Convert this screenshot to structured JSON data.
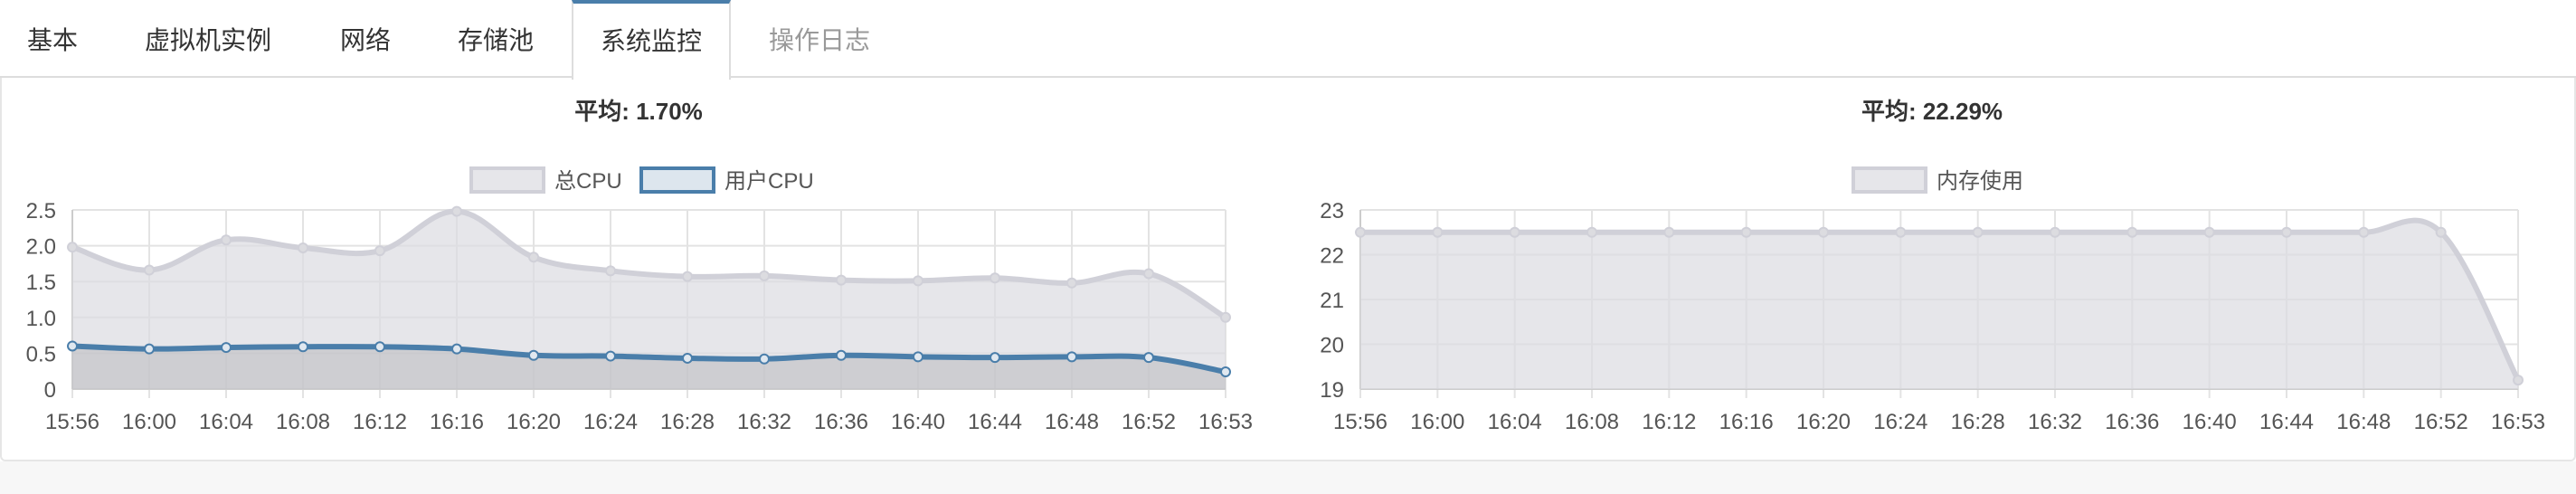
{
  "tabs": [
    {
      "label": "基本",
      "active": false,
      "disabled": false
    },
    {
      "label": "虚拟机实例",
      "active": false,
      "disabled": false
    },
    {
      "label": "网络",
      "active": false,
      "disabled": false
    },
    {
      "label": "存储池",
      "active": false,
      "disabled": false
    },
    {
      "label": "系统监控",
      "active": true,
      "disabled": false
    },
    {
      "label": "操作日志",
      "active": false,
      "disabled": true
    }
  ],
  "colors": {
    "accent": "#4a7eaa",
    "grey_series": "#d0d0d8",
    "grey_fill": "#e5e5e5",
    "grid": "#dddddd",
    "tab_border": "#dddddd"
  },
  "chart_data": [
    {
      "type": "area",
      "title": "平均: 1.70%",
      "legend_position": "top-center",
      "grid": true,
      "x": [
        "15:56",
        "16:00",
        "16:04",
        "16:08",
        "16:12",
        "16:16",
        "16:20",
        "16:24",
        "16:28",
        "16:32",
        "16:36",
        "16:40",
        "16:44",
        "16:48",
        "16:52",
        "16:53"
      ],
      "yticks": [
        "0",
        "0.5",
        "1.0",
        "1.5",
        "2.0",
        "2.5"
      ],
      "ylim": [
        0,
        2.5
      ],
      "series": [
        {
          "name": "总CPU",
          "color": "#d0d0d8",
          "values": [
            1.98,
            1.66,
            2.08,
            1.97,
            1.93,
            2.48,
            1.84,
            1.65,
            1.57,
            1.58,
            1.52,
            1.51,
            1.55,
            1.48,
            1.61,
            1.0
          ]
        },
        {
          "name": "用户CPU",
          "color": "#4a7eaa",
          "values": [
            0.6,
            0.56,
            0.58,
            0.59,
            0.59,
            0.56,
            0.47,
            0.46,
            0.43,
            0.42,
            0.47,
            0.45,
            0.44,
            0.45,
            0.44,
            0.24
          ]
        }
      ]
    },
    {
      "type": "area",
      "title": "平均: 22.29%",
      "legend_position": "top-center",
      "grid": true,
      "x": [
        "15:56",
        "16:00",
        "16:04",
        "16:08",
        "16:12",
        "16:16",
        "16:20",
        "16:24",
        "16:28",
        "16:32",
        "16:36",
        "16:40",
        "16:44",
        "16:48",
        "16:52",
        "16:53"
      ],
      "yticks": [
        "19",
        "20",
        "21",
        "22",
        "23"
      ],
      "ylim": [
        19,
        23
      ],
      "series": [
        {
          "name": "内存使用",
          "color": "#d0d0d8",
          "values": [
            22.5,
            22.5,
            22.5,
            22.5,
            22.5,
            22.5,
            22.5,
            22.5,
            22.5,
            22.5,
            22.5,
            22.5,
            22.5,
            22.5,
            22.5,
            19.2
          ]
        }
      ]
    }
  ]
}
